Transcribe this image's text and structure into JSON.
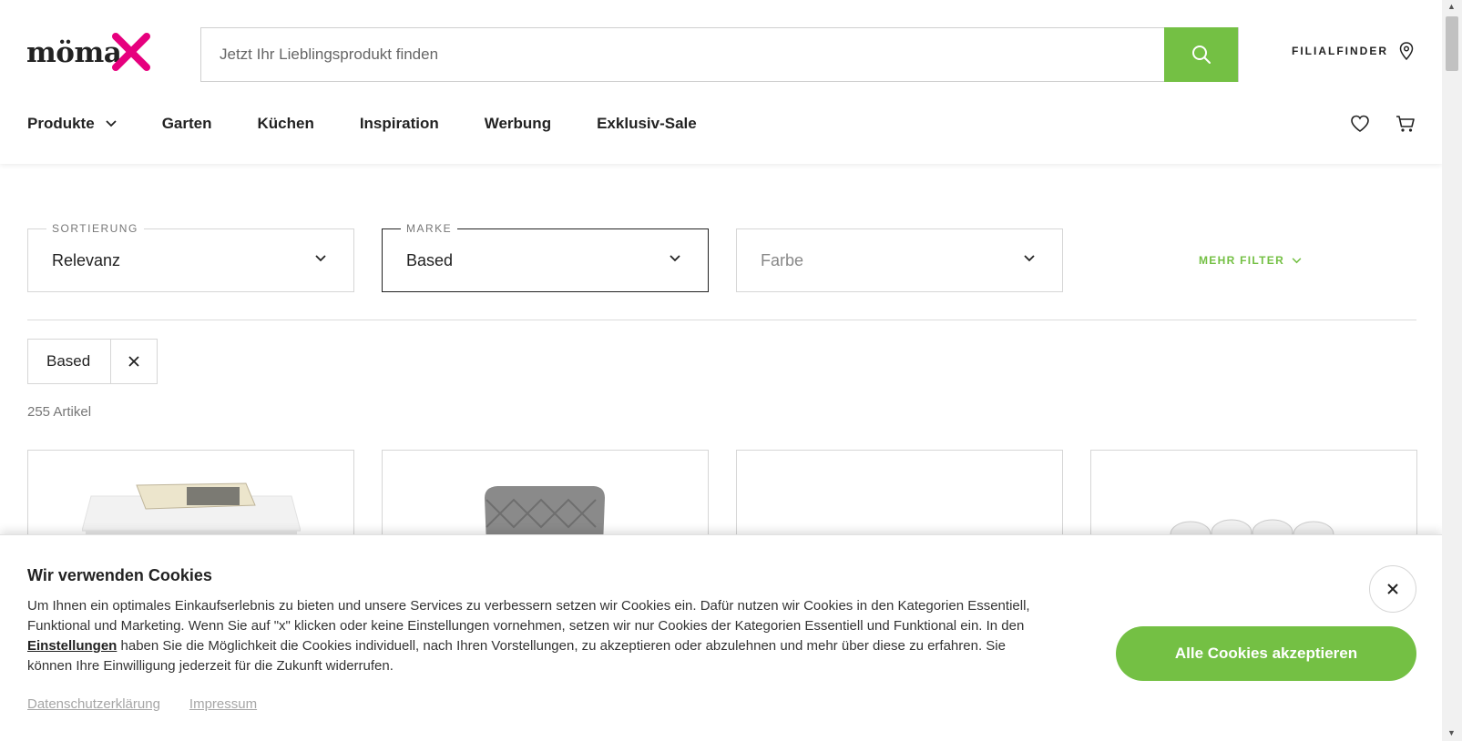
{
  "brand": {
    "logo_text": "möma",
    "accent_color": "#e6007e",
    "green": "#74c044"
  },
  "search": {
    "placeholder": "Jetzt Ihr Lieblingsprodukt finden",
    "button_icon": "search-icon"
  },
  "header": {
    "filialfinder_label": "FILIALFINDER",
    "filialfinder_icon": "location-pin-icon"
  },
  "nav": {
    "items": [
      {
        "label": "Produkte",
        "has_dropdown": true
      },
      {
        "label": "Garten"
      },
      {
        "label": "Küchen"
      },
      {
        "label": "Inspiration"
      },
      {
        "label": "Werbung"
      },
      {
        "label": "Exklusiv-Sale"
      }
    ],
    "icons": [
      "heart-icon",
      "cart-icon"
    ]
  },
  "filters": {
    "sortierung": {
      "legend": "SORTIERUNG",
      "value": "Relevanz"
    },
    "marke": {
      "legend": "MARKE",
      "value": "Based"
    },
    "farbe": {
      "placeholder": "Farbe"
    },
    "mehr_filter_label": "MEHR FILTER"
  },
  "active_filter_chip": {
    "label": "Based"
  },
  "result_count": "255 Artikel",
  "cookie_banner": {
    "title": "Wir verwenden Cookies",
    "text_part1": "Um Ihnen ein optimales Einkaufserlebnis zu bieten und unsere Services zu verbessern setzen wir Cookies ein. Dafür nutzen wir Cookies in den Kategorien Essentiell, Funktional und Marketing. Wenn Sie auf \"x\" klicken oder keine Einstellungen vornehmen, setzen wir nur Cookies der Kategorien Essentiell und Funktional ein. In den ",
    "settings_link": "Einstellungen",
    "text_part2": " haben Sie die Möglichkeit die Cookies individuell, nach Ihren Vorstellungen, zu akzeptieren oder abzulehnen und mehr über diese zu erfahren. Sie können Ihre Einwilligung jederzeit für die Zukunft widerrufen.",
    "privacy_link": "Datenschutzerklärung",
    "imprint_link": "Impressum",
    "accept_label": "Alle Cookies akzeptieren"
  }
}
